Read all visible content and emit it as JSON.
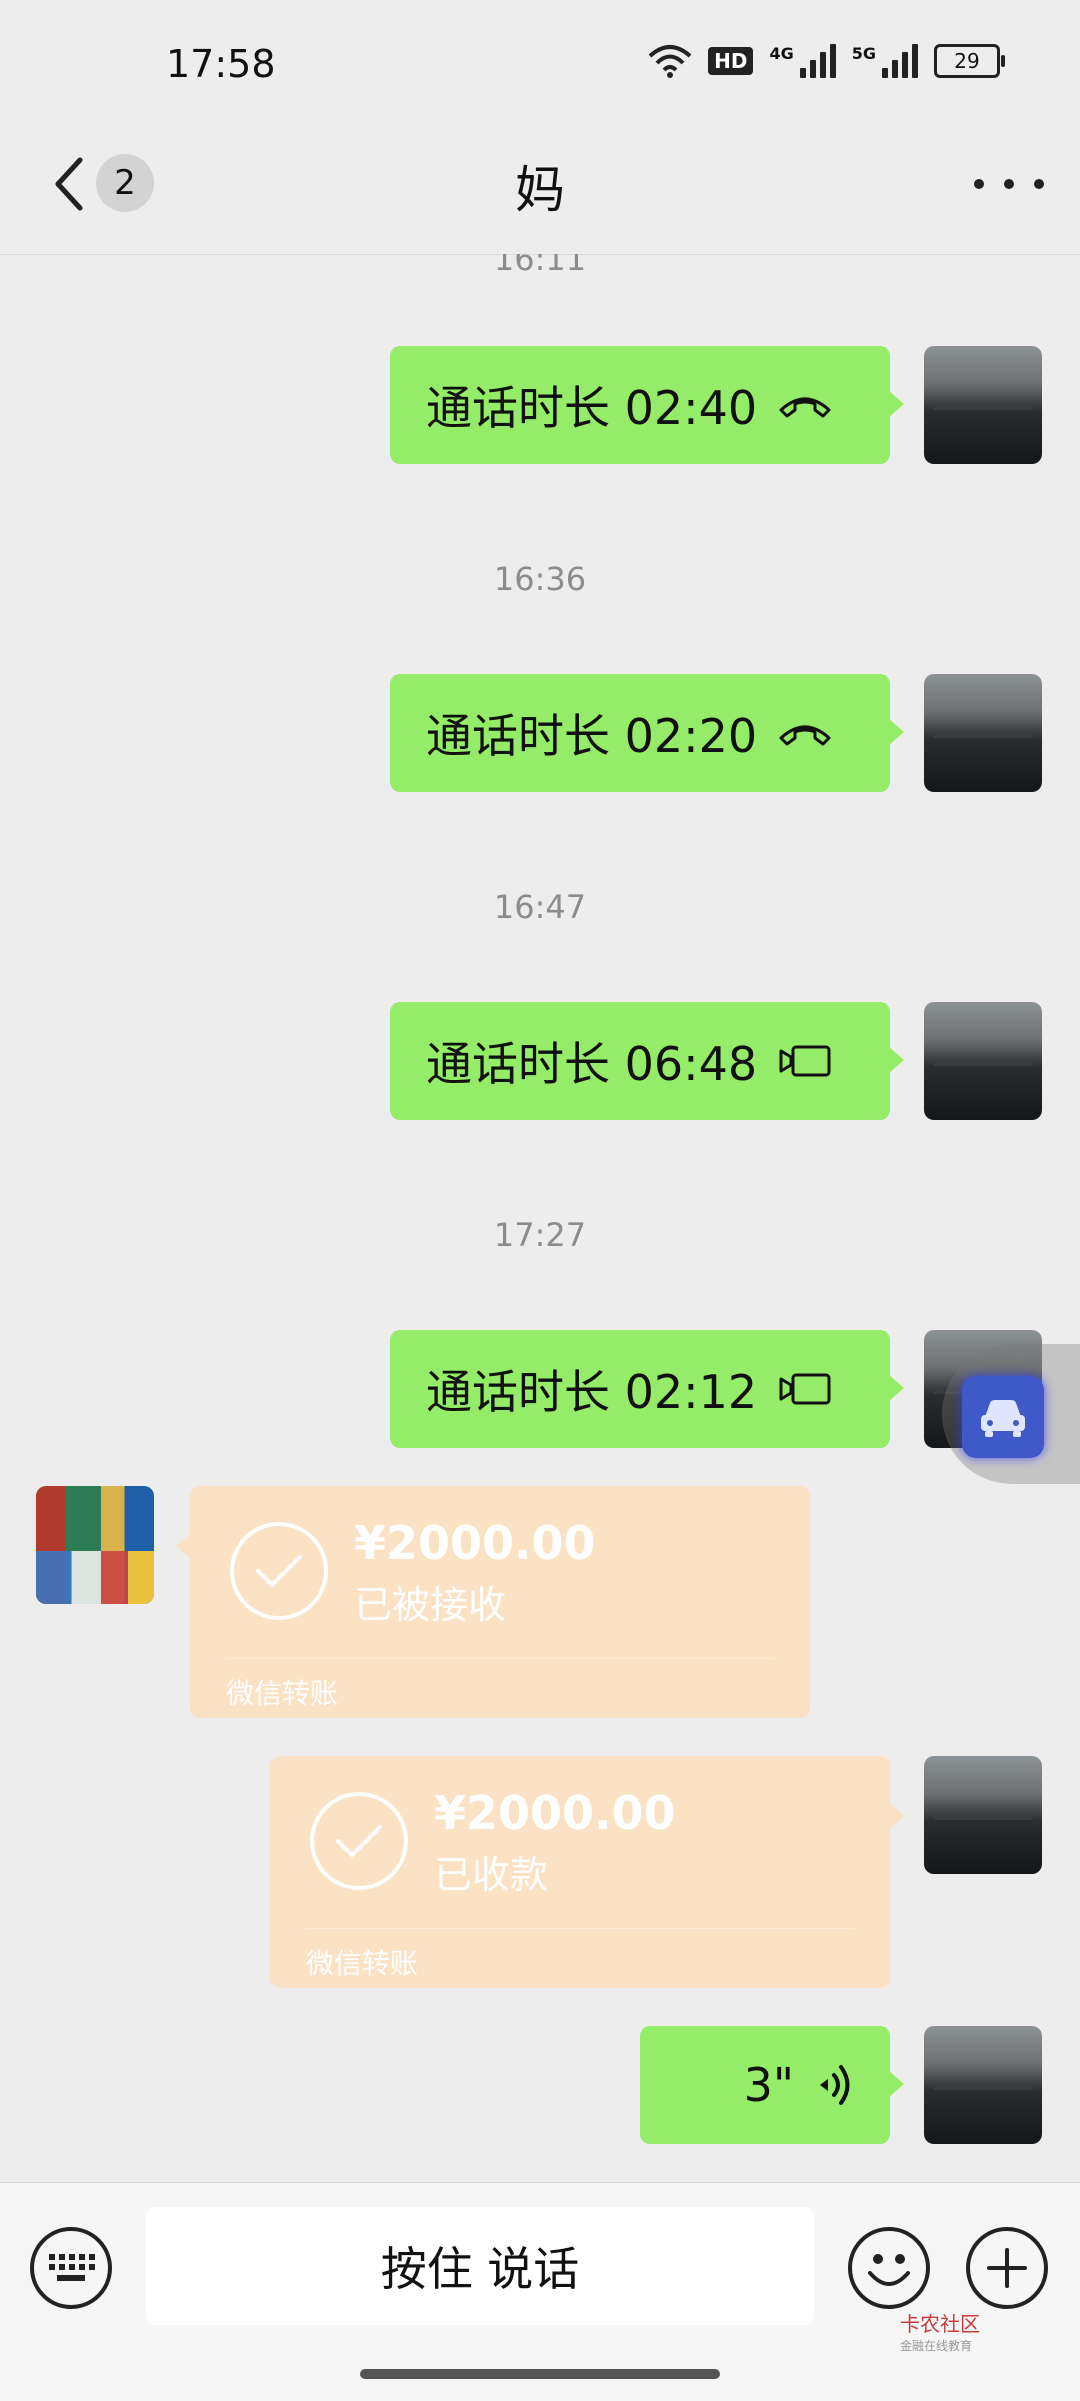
{
  "status_bar": {
    "time": "17:58",
    "hd": "HD",
    "net1": "4G",
    "net2": "5G",
    "battery": "29"
  },
  "header": {
    "unread_count": "2",
    "title": "妈"
  },
  "chat": {
    "timestamps": [
      "16:11",
      "16:36",
      "16:47",
      "17:27"
    ],
    "messages": [
      {
        "text": "通话时长 02:40",
        "icon": "phone-hangup-icon"
      },
      {
        "text": "通话时长 02:20",
        "icon": "phone-hangup-icon"
      },
      {
        "text": "通话时长 06:48",
        "icon": "video-call-icon"
      },
      {
        "text": "通话时长 02:12",
        "icon": "video-call-icon"
      }
    ],
    "transfer_received": {
      "amount": "¥2000.00",
      "status": "已被接收",
      "label": "微信转账"
    },
    "transfer_sent": {
      "amount": "¥2000.00",
      "status": "已收款",
      "label": "微信转账"
    },
    "voice": {
      "duration": "3\""
    }
  },
  "bottom_bar": {
    "talk_label": "按住 说话",
    "watermark_main": "卡农社区",
    "watermark_sub": "金融在线教育"
  },
  "colors": {
    "bubble_green": "#95ec69",
    "transfer_orange": "#fbe2c5",
    "background": "#ededed"
  }
}
